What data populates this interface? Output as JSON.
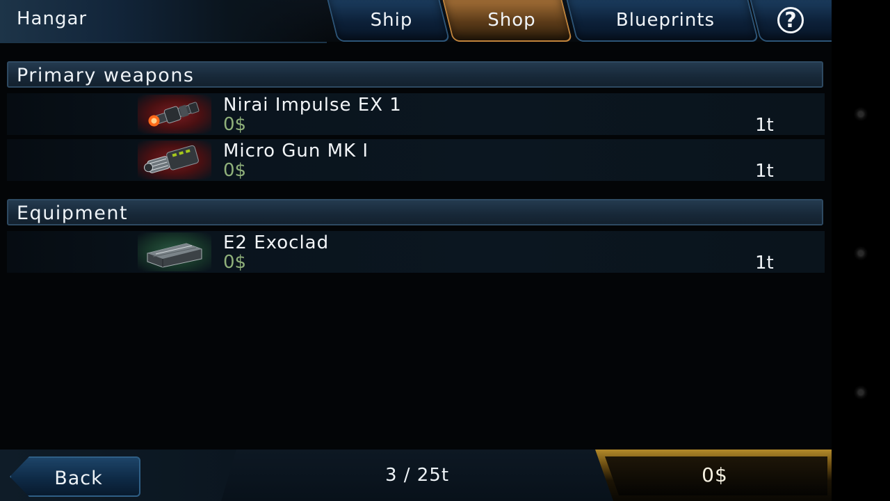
{
  "header": {
    "title": "Hangar",
    "tabs": [
      {
        "label": "Ship",
        "active": false
      },
      {
        "label": "Shop",
        "active": true
      },
      {
        "label": "Blueprints",
        "active": false
      }
    ],
    "help_label": "?"
  },
  "sections": [
    {
      "title": "Primary weapons",
      "items": [
        {
          "name": "Nirai Impulse EX 1",
          "price": "0$",
          "weight": "1t",
          "icon": "impulse-cannon-icon"
        },
        {
          "name": "Micro Gun MK I",
          "price": "0$",
          "weight": "1t",
          "icon": "gatling-gun-icon"
        }
      ]
    },
    {
      "title": "Equipment",
      "items": [
        {
          "name": "E2 Exoclad",
          "price": "0$",
          "weight": "1t",
          "icon": "armor-plate-icon"
        }
      ]
    }
  ],
  "footer": {
    "back_label": "Back",
    "capacity": "3 / 25t",
    "money": "0$"
  },
  "colors": {
    "tab_active": "#a26e36",
    "tab_inactive": "#1b3c5e",
    "price_green": "#8fb07a",
    "money_gold": "#b38a2a"
  }
}
